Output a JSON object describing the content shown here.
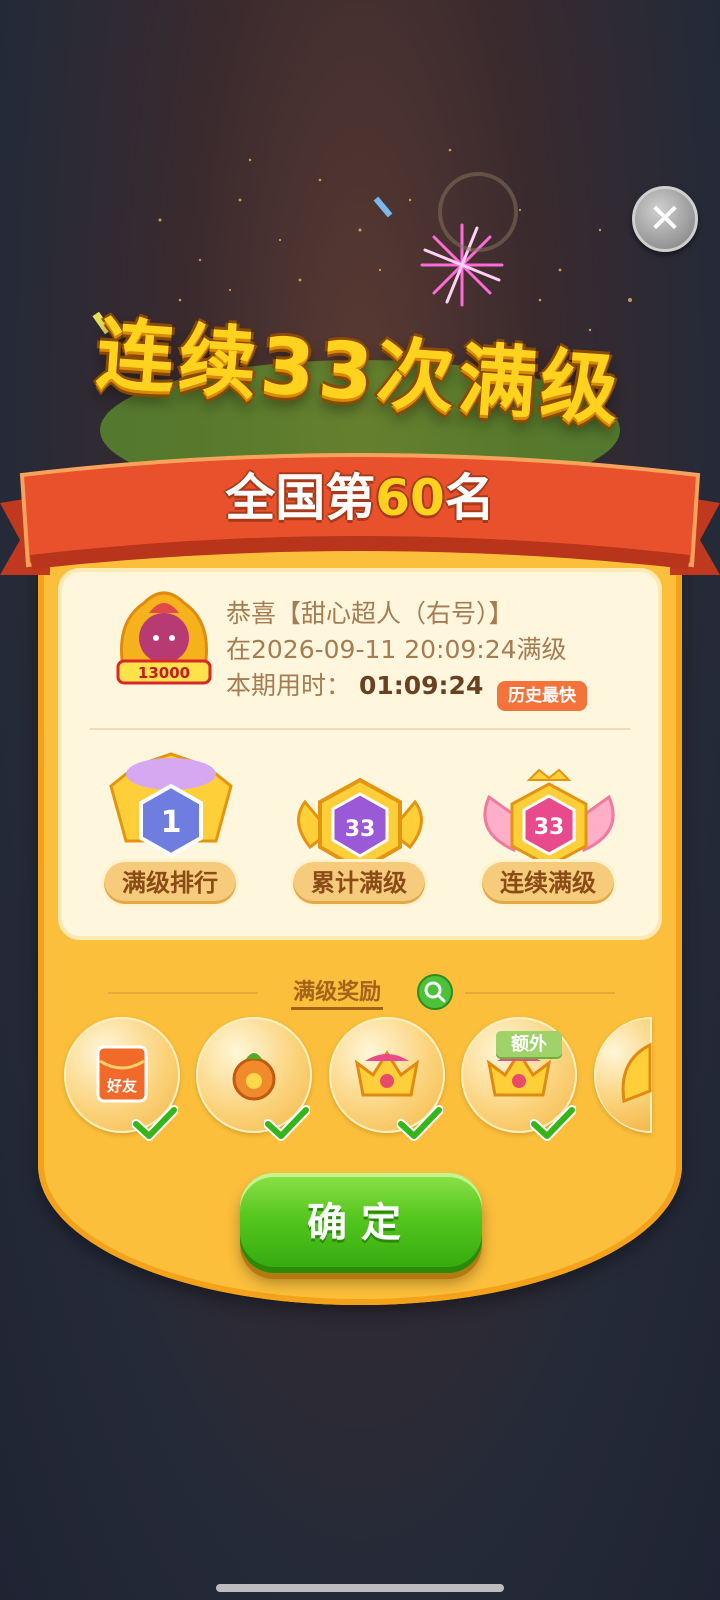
{
  "dialog": {
    "headline": "连续33次满级",
    "rank_prefix": "全国第",
    "rank_number": "60",
    "rank_suffix": "名"
  },
  "user": {
    "congrats": "恭喜【甜心超人（右号）】",
    "reached": "在2026-09-11 20:09:24满级",
    "time_label": "本期用时：",
    "time_value": "01:09:24",
    "best_badge": "历史最快",
    "badge_score": "13000"
  },
  "medals": [
    {
      "label": "满级排行",
      "number": "1"
    },
    {
      "label": "累计满级",
      "number": "33"
    },
    {
      "label": "连续满级",
      "number": "33"
    }
  ],
  "rewards": {
    "title": "满级奖励",
    "items": [
      {
        "name": "好友",
        "icon": "red-envelope-icon",
        "claimed": true
      },
      {
        "name": "",
        "icon": "fruit-bag-icon",
        "claimed": true
      },
      {
        "name": "",
        "icon": "crown-icon",
        "claimed": true
      },
      {
        "name": "",
        "icon": "crown-icon",
        "claimed": true,
        "extra": "额外"
      },
      {
        "name": "",
        "icon": "wing-icon",
        "claimed": false
      }
    ]
  },
  "buttons": {
    "confirm": "确定",
    "close": "✕"
  },
  "colors": {
    "accent": "#fbbf3b",
    "banner": "#e8512c",
    "confirm": "#55c61e"
  }
}
